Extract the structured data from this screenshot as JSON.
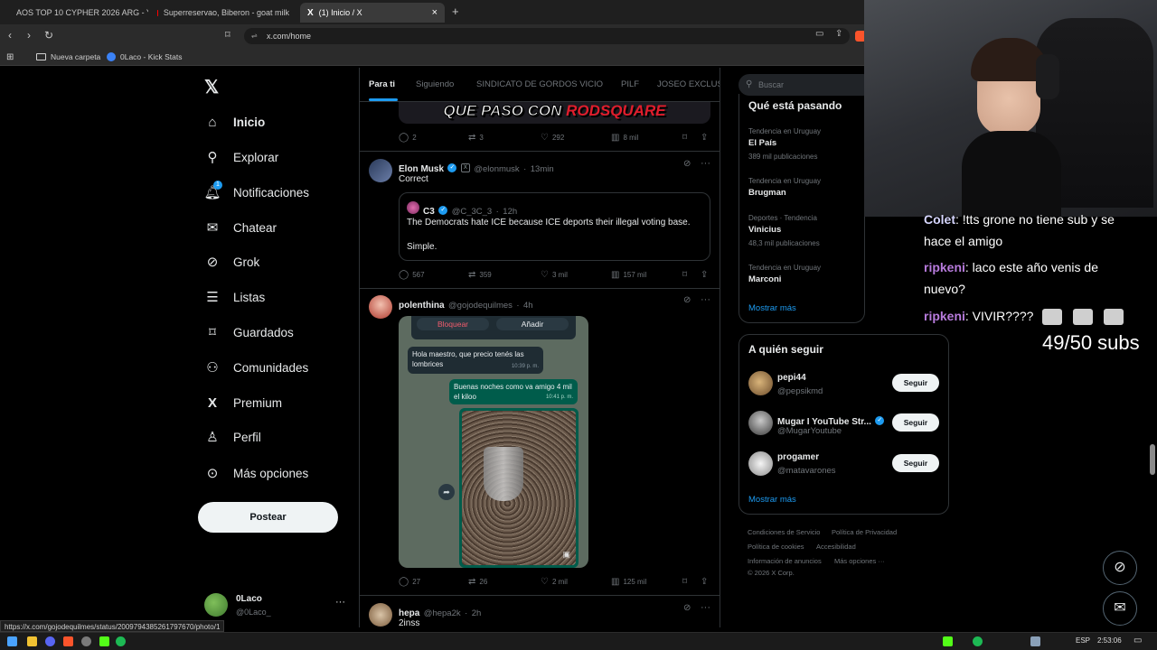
{
  "browser": {
    "tabs": [
      {
        "label": "AOS TOP 10 CYPHER 2026 ARG - You"
      },
      {
        "label": "Superreservao, Biberon - goat milk"
      },
      {
        "label": "(1) Inicio / X"
      }
    ],
    "url": "x.com/home",
    "bookmarks": [
      {
        "label": "Nueva carpeta"
      },
      {
        "label": "0Laco - Kick Stats"
      }
    ],
    "status_url": "https://x.com/gojodequilmes/status/2009794385261797670/photo/1"
  },
  "nav": {
    "items": [
      {
        "label": "Inicio"
      },
      {
        "label": "Explorar"
      },
      {
        "label": "Notificaciones"
      },
      {
        "label": "Chatear"
      },
      {
        "label": "Grok"
      },
      {
        "label": "Listas"
      },
      {
        "label": "Guardados"
      },
      {
        "label": "Comunidades"
      },
      {
        "label": "Premium"
      },
      {
        "label": "Perfil"
      },
      {
        "label": "Más opciones"
      }
    ],
    "notif_badge": "1",
    "post_label": "Postear",
    "account": {
      "name": "0Laco",
      "handle": "@0Laco_"
    }
  },
  "feed": {
    "tabs": [
      "Para ti",
      "Siguiendo",
      "SINDICATO DE GORDOS VICIO",
      "PILF",
      "JOSEO EXCLUSI"
    ],
    "banner_text": {
      "part1": "QUE PASO CON ",
      "part2": "RODSQUARE"
    },
    "prev_actions": {
      "replies": "2",
      "reposts": "3",
      "likes": "292",
      "views": "8 mil"
    },
    "tweet1": {
      "name": "Elon Musk",
      "handle": "@elonmusk",
      "time": "13min",
      "text": "Correct",
      "quote": {
        "name": "C3",
        "handle": "@C_3C_3",
        "time": "12h",
        "text1": "The Democrats hate ICE because ICE deports their illegal voting base.",
        "text2": "Simple."
      },
      "actions": {
        "replies": "567",
        "reposts": "359",
        "likes": "3 mil",
        "views": "157 mil"
      }
    },
    "tweet2": {
      "name": "polenthina",
      "handle": "@gojodequilmes",
      "time": "4h",
      "chat": {
        "block": "Bloquear",
        "add": "Añadir",
        "msg1": "Hola maestro, que precio tenés las lombrices",
        "msg1_time": "10:39 p. m.",
        "msg2": "Buenas noches como va amigo 4 mil el kiloo",
        "msg2_time": "10:41 p. m."
      },
      "actions": {
        "replies": "27",
        "reposts": "26",
        "likes": "2 mil",
        "views": "125 mil"
      }
    },
    "tweet3": {
      "name": "hepa",
      "handle": "@hepa2k",
      "time": "2h",
      "text": "2inss"
    }
  },
  "right": {
    "search_placeholder": "Buscar",
    "trends_title": "Qué está pasando",
    "trends": [
      {
        "meta": "Tendencia en Uruguay",
        "name": "El País",
        "count": "389 mil publicaciones"
      },
      {
        "meta": "Tendencia en Uruguay",
        "name": "Brugman",
        "count": ""
      },
      {
        "meta": "Deportes · Tendencia",
        "name": "Vinicius",
        "count": "48,3 mil publicaciones"
      },
      {
        "meta": "Tendencia en Uruguay",
        "name": "Marconi",
        "count": ""
      }
    ],
    "show_more": "Mostrar más",
    "follow_title": "A quién seguir",
    "follow": [
      {
        "name": "pepi44",
        "handle": "@pepsikmd",
        "btn": "Seguir"
      },
      {
        "name": "Mugar I YouTube Str...",
        "handle": "@MugarYoutube",
        "btn": "Seguir"
      },
      {
        "name": "progamer",
        "handle": "@matavarones",
        "btn": "Seguir"
      }
    ],
    "footer": {
      "l1": "Condiciones de Servicio",
      "l2": "Política de Privacidad",
      "l3": "Política de cookies",
      "l4": "Accesibilidad",
      "l5": "Información de anuncios",
      "l6": "Más opciones ···",
      "copyright": "© 2026 X Corp."
    }
  },
  "stream": {
    "chat": [
      {
        "user": "Colet",
        "text": ": !tts grone no tiene sub y se"
      },
      {
        "user": "",
        "text": "hace el amigo"
      },
      {
        "user": "ripkeni",
        "text": ": laco este año venis de"
      },
      {
        "user": "",
        "text": "nuevo?"
      },
      {
        "user": "ripkeni",
        "text": ": VIVIR????"
      }
    ],
    "subs": "49/50 subs"
  },
  "taskbar": {
    "lang": "ESP",
    "time": "2:53:06"
  },
  "colors": {
    "accent": "#1d9bf0",
    "bg": "#000000",
    "muted": "#71767b",
    "border": "#2f3336"
  }
}
